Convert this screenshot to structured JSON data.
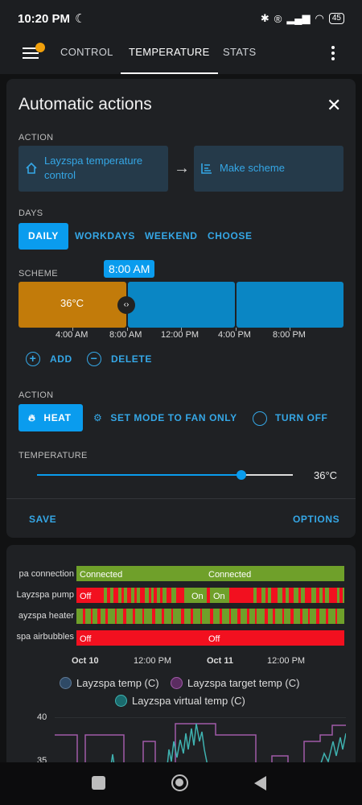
{
  "status": {
    "time": "10:20 PM",
    "battery": "45"
  },
  "nav": {
    "tabs": [
      "CONTROL",
      "TEMPERATURE",
      "STATS"
    ],
    "active": 1
  },
  "dialog": {
    "title": "Automatic actions",
    "action_label": "ACTION",
    "source_action": "Layzspa temperature control",
    "target_action": "Make scheme",
    "days_label": "DAYS",
    "days": [
      "DAILY",
      "WORKDAYS",
      "WEEKEND",
      "CHOOSE"
    ],
    "days_selected": "DAILY",
    "scheme_label": "SCHEME",
    "scheme_tooltip": "8:00 AM",
    "scheme_block_temp": "36°C",
    "scheme_ticks": [
      "4:00 AM",
      "8:00 AM",
      "12:00 PM",
      "4:00 PM",
      "8:00 PM"
    ],
    "add_label": "ADD",
    "delete_label": "DELETE",
    "mode_label": "ACTION",
    "modes": [
      "HEAT",
      "SET MODE TO FAN ONLY",
      "TURN OFF"
    ],
    "mode_selected": "HEAT",
    "temperature_label": "TEMPERATURE",
    "temperature_value": "36°C",
    "temperature_fraction": 0.8,
    "save_label": "SAVE",
    "options_label": "OPTIONS"
  },
  "history": {
    "rows": [
      {
        "label": "pa connection",
        "texts": [
          "Connected",
          "Connected"
        ]
      },
      {
        "label": "Layzspa pump",
        "texts": [
          "Off",
          "On",
          "On"
        ]
      },
      {
        "label": "ayzspa heater",
        "texts": []
      },
      {
        "label": "spa airbubbles",
        "texts": [
          "Off",
          "Off"
        ]
      }
    ],
    "x_ticks": [
      "Oct 10",
      "12:00 PM",
      "Oct 11",
      "12:00 PM"
    ],
    "legend": [
      {
        "name": "Layzspa temp (C)",
        "color": "#2f4a66"
      },
      {
        "name": "Layzspa target temp (C)",
        "color": "#5b2d61"
      },
      {
        "name": "Layzspa virtual temp (C)",
        "color": "#1a6b6e"
      }
    ],
    "y_tick": "40",
    "y_tick2": "35"
  },
  "colors": {
    "accent": "#0a9cee",
    "scheme_active": "#c27b0a",
    "green": "#6fa02a",
    "red": "#f2101f"
  }
}
